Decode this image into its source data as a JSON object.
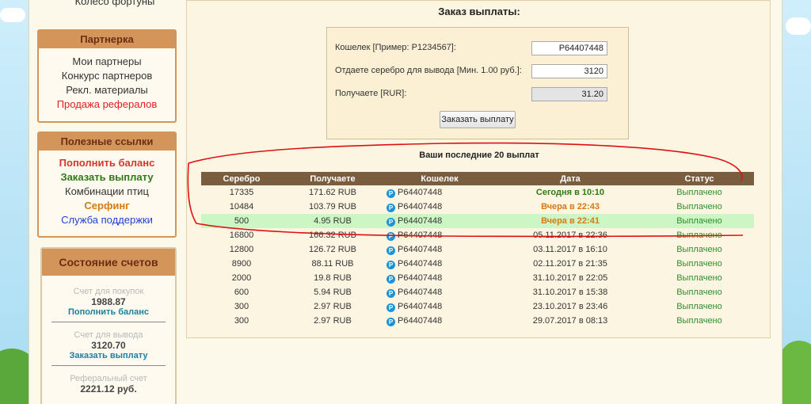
{
  "sidebar": {
    "top_item": "Колесо фортуны",
    "partner": {
      "title": "Партнерка",
      "items": [
        {
          "label": "Мои партнеры",
          "color": "#333333"
        },
        {
          "label": "Конкурс партнеров",
          "color": "#333333"
        },
        {
          "label": "Рекл. материалы",
          "color": "#333333"
        },
        {
          "label": "Продажа рефералов",
          "color": "#e02020"
        }
      ]
    },
    "links": {
      "title": "Полезные ссылки",
      "items": [
        {
          "label": "Пополнить баланс",
          "color": "#d9342b"
        },
        {
          "label": "Заказать выплату",
          "color": "#2f7a17"
        },
        {
          "label": "Комбинации птиц",
          "color": "#333333"
        },
        {
          "label": "Серфинг",
          "color": "#d67a13"
        },
        {
          "label": "Служба поддержки",
          "color": "#1f3fd6"
        }
      ]
    },
    "account": {
      "title": "Состояние счетов",
      "purchase": {
        "label": "Счет для покупок",
        "value": "1988.87",
        "link": "Пополнить баланс"
      },
      "withdraw": {
        "label": "Счет для вывода",
        "value": "3120.70",
        "link": "Заказать выплату"
      },
      "referral": {
        "label": "Реферальный счет",
        "value": "2221.12 руб."
      }
    }
  },
  "main": {
    "title": "Заказ выплаты:",
    "form": {
      "wallet_label": "Кошелек [Пример: P1234567]:",
      "wallet_value": "P64407448",
      "silver_label": "Отдаете серебро для вывода [Мин. 1.00 руб.]:",
      "silver_value": "3120",
      "receive_label": "Получаете [RUR]:",
      "receive_value": "31.20",
      "submit_label": "Заказать выплату"
    },
    "history_title": "Ваши последние 20 выплат",
    "table": {
      "headers": [
        "Серебро",
        "Получаете",
        "Кошелек",
        "Дата",
        "Статус"
      ],
      "rows": [
        {
          "silver": "17335",
          "receive": "171.62 RUB",
          "wallet": "P64407448",
          "date": "Сегодня в 10:10",
          "status": "Выплачено"
        },
        {
          "silver": "10484",
          "receive": "103.79 RUB",
          "wallet": "P64407448",
          "date": "Вчера в 22:43",
          "status": "Выплачено"
        },
        {
          "silver": "500",
          "receive": "4.95 RUB",
          "wallet": "P64407448",
          "date": "Вчера в 22:41",
          "status": "Выплачено"
        },
        {
          "silver": "16800",
          "receive": "166.32 RUB",
          "wallet": "P64407448",
          "date": "05.11.2017 в 22:36",
          "status": "Выплачено"
        },
        {
          "silver": "12800",
          "receive": "126.72 RUB",
          "wallet": "P64407448",
          "date": "03.11.2017 в 16:10",
          "status": "Выплачено"
        },
        {
          "silver": "8900",
          "receive": "88.11 RUB",
          "wallet": "P64407448",
          "date": "02.11.2017 в 21:35",
          "status": "Выплачено"
        },
        {
          "silver": "2000",
          "receive": "19.8 RUB",
          "wallet": "P64407448",
          "date": "31.10.2017 в 22:05",
          "status": "Выплачено"
        },
        {
          "silver": "600",
          "receive": "5.94 RUB",
          "wallet": "P64407448",
          "date": "31.10.2017 в 15:38",
          "status": "Выплачено"
        },
        {
          "silver": "300",
          "receive": "2.97 RUB",
          "wallet": "P64407448",
          "date": "23.10.2017 в 23:46",
          "status": "Выплачено"
        },
        {
          "silver": "300",
          "receive": "2.97 RUB",
          "wallet": "P64407448",
          "date": "29.07.2017 в 08:13",
          "status": "Выплачено"
        }
      ]
    }
  },
  "colors": {
    "accent_orange": "#d4955a",
    "table_header": "#7a5c3f",
    "highlight_row": "#ccf7c4",
    "annotation_red": "#e01010"
  },
  "icons": {
    "payeer": "payeer-p-icon"
  }
}
